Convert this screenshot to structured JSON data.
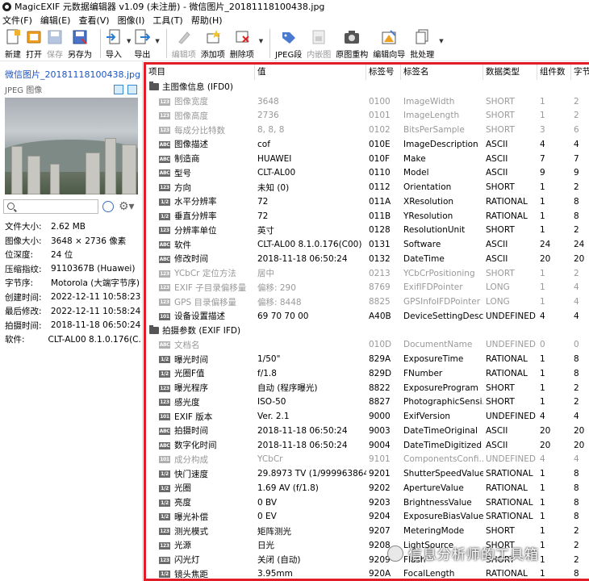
{
  "title": "MagicEXIF 元数据编辑器 v1.09 (未注册) - 微信图片_20181118100438.jpg",
  "menu": [
    "文件(F)",
    "编辑(E)",
    "查看(V)",
    "图像(I)",
    "工具(T)",
    "帮助(H)"
  ],
  "toolbar": {
    "new": "新建",
    "open": "打开",
    "save": "保存",
    "saveas": "另存为",
    "import": "导入",
    "export": "导出",
    "edit_item": "编辑项",
    "add_item": "添加项",
    "delete_item": "删除项",
    "jpeg_seg": "JPEG段",
    "embedded_img": "内嵌图",
    "rebuild": "原图重构",
    "wizard": "编辑向导",
    "batch": "批处理"
  },
  "left": {
    "filename": "微信图片_20181118100438.jpg",
    "filetype": "JPEG 图像",
    "props": [
      {
        "k": "文件大小:",
        "v": "2.62 MB"
      },
      {
        "k": "图像大小:",
        "v": "3648 × 2736 像素"
      },
      {
        "k": "位深度:",
        "v": "24 位"
      },
      {
        "k": "压缩指纹:",
        "v": "9110367B (Huawei)"
      },
      {
        "k": "字节序:",
        "v": "Motorola (大端字节序)"
      },
      {
        "k": "创建时间:",
        "v": "2022-12-11 10:58:23"
      },
      {
        "k": "最后修改:",
        "v": "2022-12-11 10:58:24"
      },
      {
        "k": "拍摄时间:",
        "v": "2018-11-18 06:50:24"
      },
      {
        "k": "软件:",
        "v": "CLT-AL00 8.1.0.176(C..."
      }
    ]
  },
  "grid": {
    "headers": [
      "项目",
      "值",
      "标签号",
      "标签名",
      "数据类型",
      "组件数",
      "字节"
    ],
    "groups": [
      {
        "name": "主图像信息 (IFD0)",
        "rows": [
          {
            "tag": "123",
            "name": "图像宽度",
            "value": "3648",
            "id": "0100",
            "tname": "ImageWidth",
            "type": "SHORT",
            "count": "1",
            "bytes": "2",
            "gray": true
          },
          {
            "tag": "123",
            "name": "图像高度",
            "value": "2736",
            "id": "0101",
            "tname": "ImageLength",
            "type": "SHORT",
            "count": "1",
            "bytes": "2",
            "gray": true
          },
          {
            "tag": "123",
            "name": "每成分比特数",
            "value": "8, 8, 8",
            "id": "0102",
            "tname": "BitsPerSample",
            "type": "SHORT",
            "count": "3",
            "bytes": "6",
            "gray": true
          },
          {
            "tag": "ABC",
            "name": "图像描述",
            "value": "cof",
            "id": "010E",
            "tname": "ImageDescription",
            "type": "ASCII",
            "count": "4",
            "bytes": "4",
            "gray": false
          },
          {
            "tag": "ABC",
            "name": "制造商",
            "value": "HUAWEI",
            "id": "010F",
            "tname": "Make",
            "type": "ASCII",
            "count": "7",
            "bytes": "7",
            "gray": false
          },
          {
            "tag": "ABC",
            "name": "型号",
            "value": "CLT-AL00",
            "id": "0110",
            "tname": "Model",
            "type": "ASCII",
            "count": "9",
            "bytes": "9",
            "gray": false
          },
          {
            "tag": "123",
            "name": "方向",
            "value": "未知 (0)",
            "id": "0112",
            "tname": "Orientation",
            "type": "SHORT",
            "count": "1",
            "bytes": "2",
            "gray": false
          },
          {
            "tag": "1/2",
            "name": "水平分辨率",
            "value": "72",
            "id": "011A",
            "tname": "XResolution",
            "type": "RATIONAL",
            "count": "1",
            "bytes": "8",
            "gray": false
          },
          {
            "tag": "1/2",
            "name": "垂直分辨率",
            "value": "72",
            "id": "011B",
            "tname": "YResolution",
            "type": "RATIONAL",
            "count": "1",
            "bytes": "8",
            "gray": false
          },
          {
            "tag": "123",
            "name": "分辨率单位",
            "value": "英寸",
            "id": "0128",
            "tname": "ResolutionUnit",
            "type": "SHORT",
            "count": "1",
            "bytes": "2",
            "gray": false
          },
          {
            "tag": "ABC",
            "name": "软件",
            "value": "CLT-AL00 8.1.0.176(C00)",
            "id": "0131",
            "tname": "Software",
            "type": "ASCII",
            "count": "24",
            "bytes": "24",
            "gray": false
          },
          {
            "tag": "ABC",
            "name": "修改时间",
            "value": "2018-11-18 06:50:24",
            "id": "0132",
            "tname": "DateTime",
            "type": "ASCII",
            "count": "20",
            "bytes": "20",
            "gray": false
          },
          {
            "tag": "123",
            "name": "YCbCr 定位方法",
            "value": "居中",
            "id": "0213",
            "tname": "YCbCrPositioning",
            "type": "SHORT",
            "count": "1",
            "bytes": "2",
            "gray": true
          },
          {
            "tag": "123",
            "name": "EXIF 子目录偏移量",
            "value": "偏移: 290",
            "id": "8769",
            "tname": "ExifIFDPointer",
            "type": "LONG",
            "count": "1",
            "bytes": "4",
            "gray": true
          },
          {
            "tag": "123",
            "name": "GPS 目录偏移量",
            "value": "偏移: 8448",
            "id": "8825",
            "tname": "GPSInfoIFDPointer",
            "type": "LONG",
            "count": "1",
            "bytes": "4",
            "gray": true
          },
          {
            "tag": "101",
            "name": "设备设置描述",
            "value": "69 70 70 00",
            "id": "A40B",
            "tname": "DeviceSettingDesc...",
            "type": "UNDEFINED",
            "count": "4",
            "bytes": "4",
            "gray": false
          }
        ]
      },
      {
        "name": "拍摄参数 (EXIF IFD)",
        "rows": [
          {
            "tag": "ABC",
            "name": "文档名",
            "value": "",
            "id": "010D",
            "tname": "DocumentName",
            "type": "UNDEFINED",
            "count": "0",
            "bytes": "0",
            "gray": true
          },
          {
            "tag": "1/2",
            "name": "曝光时间",
            "value": "1/50\"",
            "id": "829A",
            "tname": "ExposureTime",
            "type": "RATIONAL",
            "count": "1",
            "bytes": "8",
            "gray": false
          },
          {
            "tag": "1/2",
            "name": "光圈F值",
            "value": "f/1.8",
            "id": "829D",
            "tname": "FNumber",
            "type": "RATIONAL",
            "count": "1",
            "bytes": "8",
            "gray": false
          },
          {
            "tag": "123",
            "name": "曝光程序",
            "value": "自动 (程序曝光)",
            "id": "8822",
            "tname": "ExposureProgram",
            "type": "SHORT",
            "count": "1",
            "bytes": "2",
            "gray": false
          },
          {
            "tag": "123",
            "name": "感光度",
            "value": "ISO-50",
            "id": "8827",
            "tname": "PhotographicSensi...",
            "type": "SHORT",
            "count": "1",
            "bytes": "2",
            "gray": false
          },
          {
            "tag": "101",
            "name": "EXIF 版本",
            "value": "Ver. 2.1",
            "id": "9000",
            "tname": "ExifVersion",
            "type": "UNDEFINED",
            "count": "4",
            "bytes": "4",
            "gray": false
          },
          {
            "tag": "ABC",
            "name": "拍摄时间",
            "value": "2018-11-18 06:50:24",
            "id": "9003",
            "tname": "DateTimeOriginal",
            "type": "ASCII",
            "count": "20",
            "bytes": "20",
            "gray": false
          },
          {
            "tag": "ABC",
            "name": "数字化时间",
            "value": "2018-11-18 06:50:24",
            "id": "9004",
            "tname": "DateTimeDigitized",
            "type": "ASCII",
            "count": "20",
            "bytes": "20",
            "gray": false
          },
          {
            "tag": "101",
            "name": "成分构成",
            "value": "YCbCr",
            "id": "9101",
            "tname": "ComponentsConfi...",
            "type": "UNDEFINED",
            "count": "4",
            "bytes": "4",
            "gray": true
          },
          {
            "tag": "1/2",
            "name": "快门速度",
            "value": "29.8973 TV (1/999963864\")",
            "id": "9201",
            "tname": "ShutterSpeedValue",
            "type": "SRATIONAL",
            "count": "1",
            "bytes": "8",
            "gray": false
          },
          {
            "tag": "1/2",
            "name": "光圈",
            "value": "1.69 AV (f/1.8)",
            "id": "9202",
            "tname": "ApertureValue",
            "type": "RATIONAL",
            "count": "1",
            "bytes": "8",
            "gray": false
          },
          {
            "tag": "1/2",
            "name": "亮度",
            "value": "0 BV",
            "id": "9203",
            "tname": "BrightnessValue",
            "type": "SRATIONAL",
            "count": "1",
            "bytes": "8",
            "gray": false
          },
          {
            "tag": "1/2",
            "name": "曝光补偿",
            "value": "0 EV",
            "id": "9204",
            "tname": "ExposureBiasValue",
            "type": "SRATIONAL",
            "count": "1",
            "bytes": "8",
            "gray": false
          },
          {
            "tag": "123",
            "name": "测光模式",
            "value": "矩阵测光",
            "id": "9207",
            "tname": "MeteringMode",
            "type": "SHORT",
            "count": "1",
            "bytes": "2",
            "gray": false
          },
          {
            "tag": "123",
            "name": "光源",
            "value": "日光",
            "id": "9208",
            "tname": "LightSource",
            "type": "SHORT",
            "count": "1",
            "bytes": "2",
            "gray": false
          },
          {
            "tag": "123",
            "name": "闪光灯",
            "value": "关闭 (自动)",
            "id": "9209",
            "tname": "Flash",
            "type": "SHORT",
            "count": "1",
            "bytes": "2",
            "gray": false
          },
          {
            "tag": "1/2",
            "name": "镜头焦距",
            "value": "3.95mm",
            "id": "920A",
            "tname": "FocalLength",
            "type": "RATIONAL",
            "count": "1",
            "bytes": "8",
            "gray": false
          }
        ]
      }
    ]
  },
  "watermark": "信息分析师的工具箱"
}
